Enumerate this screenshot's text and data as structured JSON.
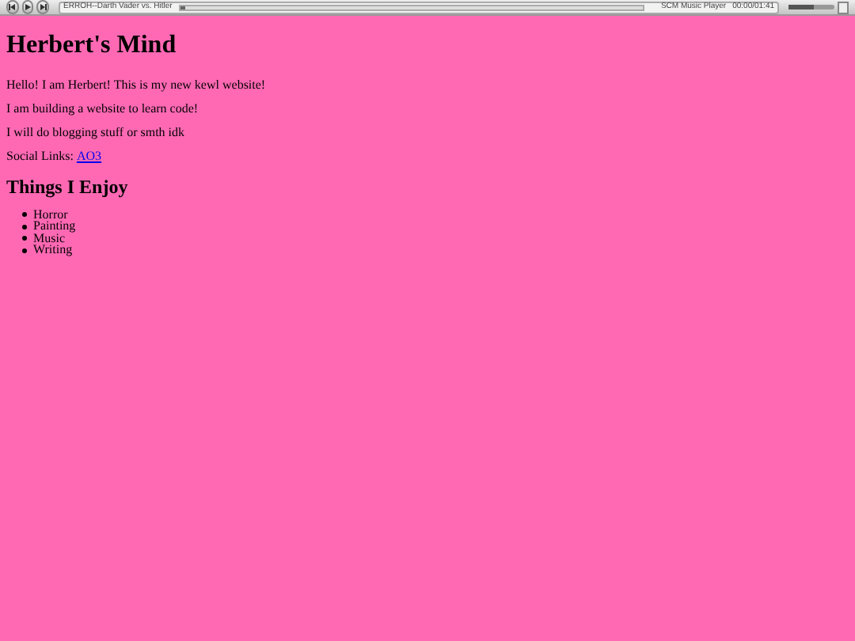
{
  "player": {
    "track": "ERROH--Darth Vader vs. Hitler",
    "progress": {
      "level": 0.01
    },
    "name": "SCM Music Player",
    "time": "00:00/01:41",
    "volume": {
      "level": 0.55
    }
  },
  "page": {
    "title": "Herbert's Mind",
    "paragraphs": [
      "Hello! I am Herbert! This is my new kewl website!",
      "I am building a website to learn code!",
      "I will do blogging stuff or smth idk"
    ],
    "social": {
      "label": "Social Links:",
      "link": "AO3"
    },
    "heading": "Things I Enjoy",
    "items": [
      "Horror",
      "Painting",
      "Music",
      "Writing"
    ]
  }
}
